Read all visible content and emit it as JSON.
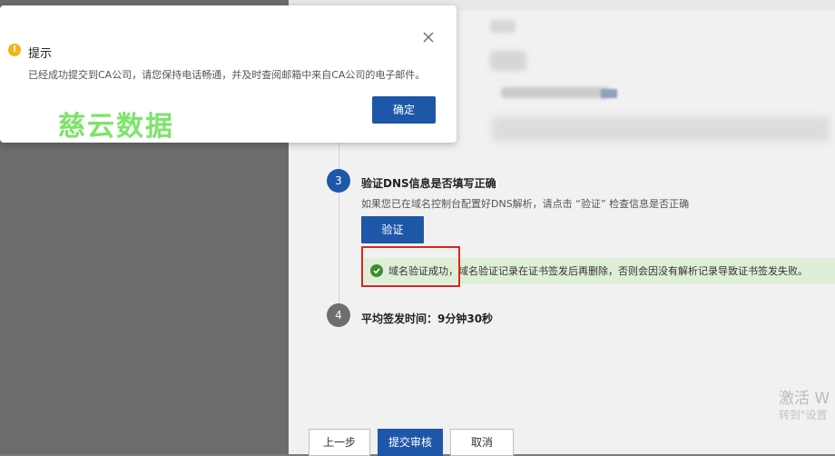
{
  "steps": {
    "step3": {
      "number": "3",
      "title": "验证DNS信息是否填写正确",
      "description": "如果您已在域名控制台配置好DNS解析，请点击 “验证” 检查信息是否正确",
      "verify_button": "验证"
    },
    "step4": {
      "number": "4",
      "title": "平均签发时间：9分钟30秒"
    }
  },
  "success_message": {
    "highlighted": "域名验证成功，",
    "rest": "域名验证记录在证书签发后再删除，否则会因没有解析记录导致证书签发失败。"
  },
  "footer": {
    "prev_label": "上一步",
    "submit_label": "提交审核",
    "cancel_label": "取消"
  },
  "dialog": {
    "title": "提示",
    "message": "已经成功提交到CA公司，请您保持电话畅通，并及时查阅邮箱中来自CA公司的电子邮件。",
    "ok_label": "确定"
  },
  "watermark": {
    "brand": "慈云数据",
    "windows_line1": "激活 W",
    "windows_line2": "转到\"设置"
  },
  "colors": {
    "primary": "#1f57a8",
    "success_bg": "#dfeed7",
    "success_icon": "#3c8d2f",
    "highlight_border": "#d9261c",
    "warning": "#f4b41a"
  },
  "icons": {
    "dialog_warning": "exclamation-circle-icon",
    "dialog_close": "close-icon",
    "success": "check-circle-icon"
  }
}
